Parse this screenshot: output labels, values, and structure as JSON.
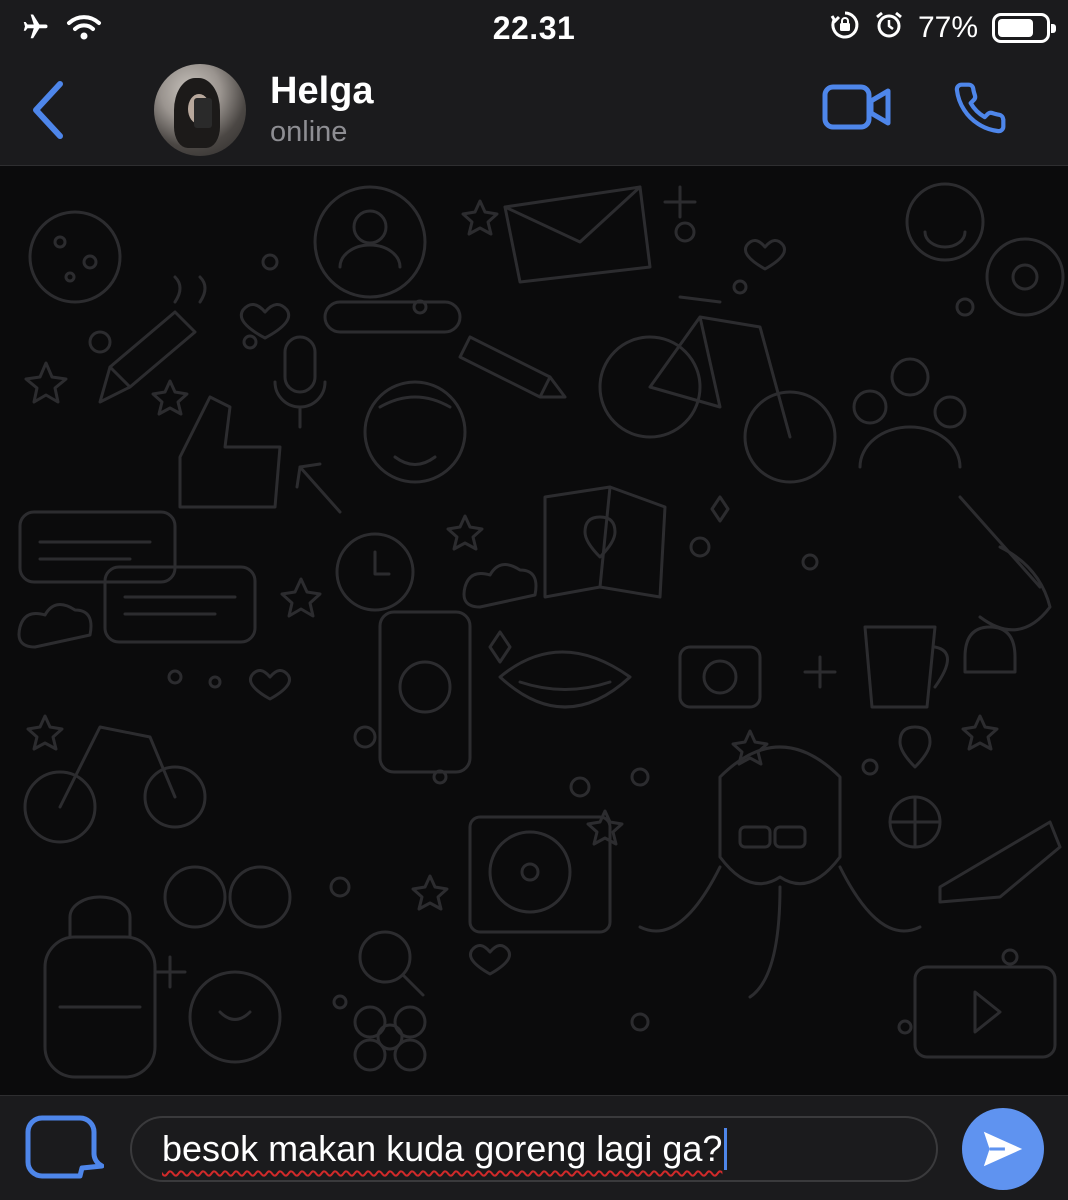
{
  "status_bar": {
    "time": "22.31",
    "battery_percent": "77%",
    "battery_level": 0.77,
    "icons": [
      "airplane-icon",
      "wifi-icon",
      "orientation-lock-icon",
      "alarm-icon",
      "battery-icon"
    ]
  },
  "header": {
    "contact_name": "Helga",
    "contact_status": "online",
    "icons": [
      "back-chevron-icon",
      "video-call-icon",
      "voice-call-icon"
    ]
  },
  "composer": {
    "message_text": "besok makan kuda goreng lagi ga?",
    "icons": [
      "sticker-icon",
      "send-icon"
    ]
  },
  "colors": {
    "accent": "#4e86ea",
    "send_button": "#5f93f0",
    "bar_background": "#1b1b1d",
    "chat_background": "#0b0b0c",
    "doodle_stroke": "#2c2c2f",
    "secondary_text": "#8e8e93",
    "spellcheck": "#d12a2a"
  }
}
